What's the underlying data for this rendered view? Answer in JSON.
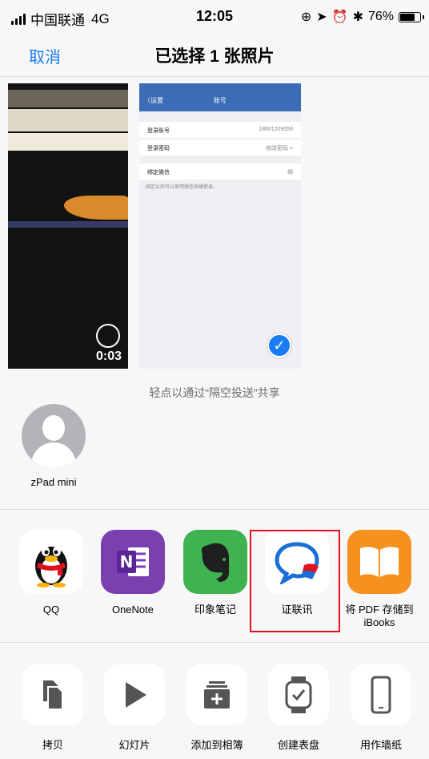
{
  "status_bar": {
    "carrier": "中国联通",
    "network": "4G",
    "time": "12:05",
    "battery_text": "76%",
    "battery_level": 0.76
  },
  "nav": {
    "cancel_label": "取消",
    "title": "已选择 1 张照片"
  },
  "photos": {
    "video_duration": "0:03",
    "screenshot": {
      "back": "〈设置",
      "title": "账号",
      "rows": [
        {
          "label": "登录账号",
          "value": "18601209056"
        },
        {
          "label": "登录密码",
          "value": "修改密码 >"
        },
        {
          "label": "绑定微信",
          "value": "绑"
        }
      ],
      "note": "绑定以后可以使用微信快捷登录。"
    }
  },
  "airdrop": {
    "hint": "轻点以通过“隔空投送”共享",
    "contacts": [
      {
        "name": "zPad mini"
      }
    ]
  },
  "apps": [
    {
      "name": "QQ",
      "icon": "qq-penguin-icon"
    },
    {
      "name": "OneNote",
      "icon": "onenote-icon"
    },
    {
      "name": "印象笔记",
      "icon": "evernote-elephant-icon"
    },
    {
      "name": "证联讯",
      "icon": "chat-bubble-icon"
    },
    {
      "name": "将 PDF 存储到 iBooks",
      "icon": "ibooks-icon"
    }
  ],
  "actions": [
    {
      "name": "拷贝",
      "icon": "copy-icon"
    },
    {
      "name": "幻灯片",
      "icon": "play-icon"
    },
    {
      "name": "添加到相簿",
      "icon": "add-album-icon"
    },
    {
      "name": "创建表盘",
      "icon": "watch-icon"
    },
    {
      "name": "用作墙纸",
      "icon": "phone-icon"
    }
  ],
  "colors": {
    "accent": "#1a7cf4",
    "highlight": "#e0121e"
  }
}
